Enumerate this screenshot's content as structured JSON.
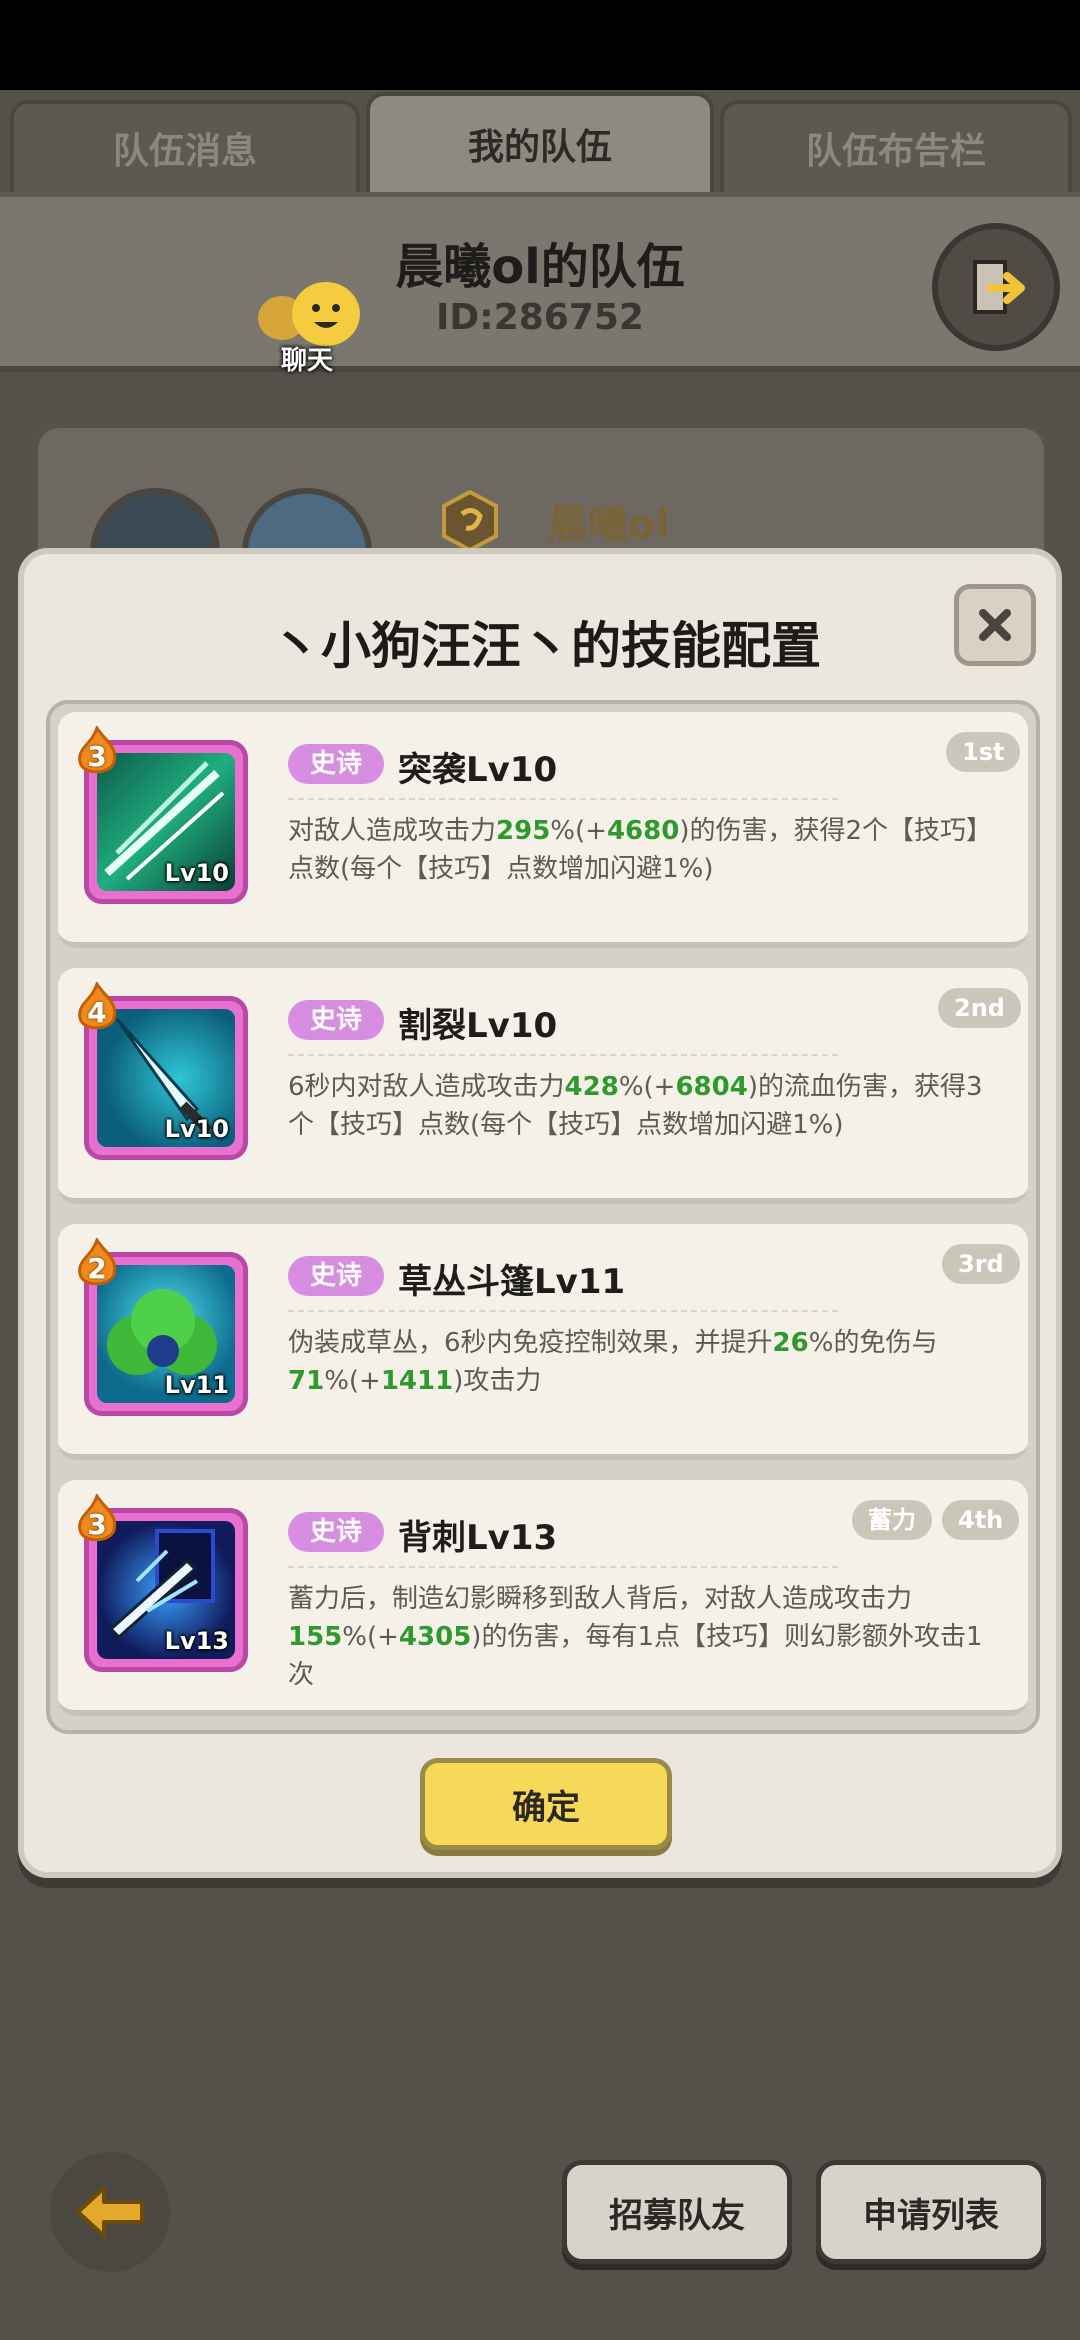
{
  "tabs": [
    {
      "label": "队伍消息"
    },
    {
      "label": "我的队伍"
    },
    {
      "label": "队伍布告栏"
    }
  ],
  "header": {
    "team_name": "晨曦ol的队伍",
    "team_id": "ID:286752",
    "chat_label": "聊天"
  },
  "member": {
    "name": "晨曦ol"
  },
  "modal": {
    "title": "丶小狗汪汪丶的技能配置",
    "confirm_label": "确定",
    "skills": [
      {
        "rank": "3",
        "tier": "史诗",
        "name": "突袭Lv10",
        "level": "Lv10",
        "order": "1st",
        "extra_tag": "",
        "desc": [
          "对敌人造成攻击力",
          "295",
          "%(+",
          "4680",
          ")的伤害，获得2个【技巧】点数(每个【技巧】点数增加闪避1%)"
        ]
      },
      {
        "rank": "4",
        "tier": "史诗",
        "name": "割裂Lv10",
        "level": "Lv10",
        "order": "2nd",
        "extra_tag": "",
        "desc": [
          "6秒内对敌人造成攻击力",
          "428",
          "%(+",
          "6804",
          ")的流血伤害，获得3个【技巧】点数(每个【技巧】点数增加闪避1%)"
        ]
      },
      {
        "rank": "2",
        "tier": "史诗",
        "name": "草丛斗篷Lv11",
        "level": "Lv11",
        "order": "3rd",
        "extra_tag": "",
        "desc": [
          "伪装成草丛，6秒内免疫控制效果，并提升",
          "26",
          "%的免伤与",
          "71",
          "%(+",
          "1411",
          ")攻击力"
        ]
      },
      {
        "rank": "3",
        "tier": "史诗",
        "name": "背刺Lv13",
        "level": "Lv13",
        "order": "4th",
        "extra_tag": "蓄力",
        "desc": [
          "蓄力后，制造幻影瞬移到敌人背后，对敌人造成攻击力",
          "155",
          "%(+",
          "4305",
          ")的伤害，每有1点【技巧】则幻影额外攻击1次"
        ]
      }
    ]
  },
  "bottom": {
    "recruit_label": "招募队友",
    "apply_list_label": "申请列表"
  }
}
